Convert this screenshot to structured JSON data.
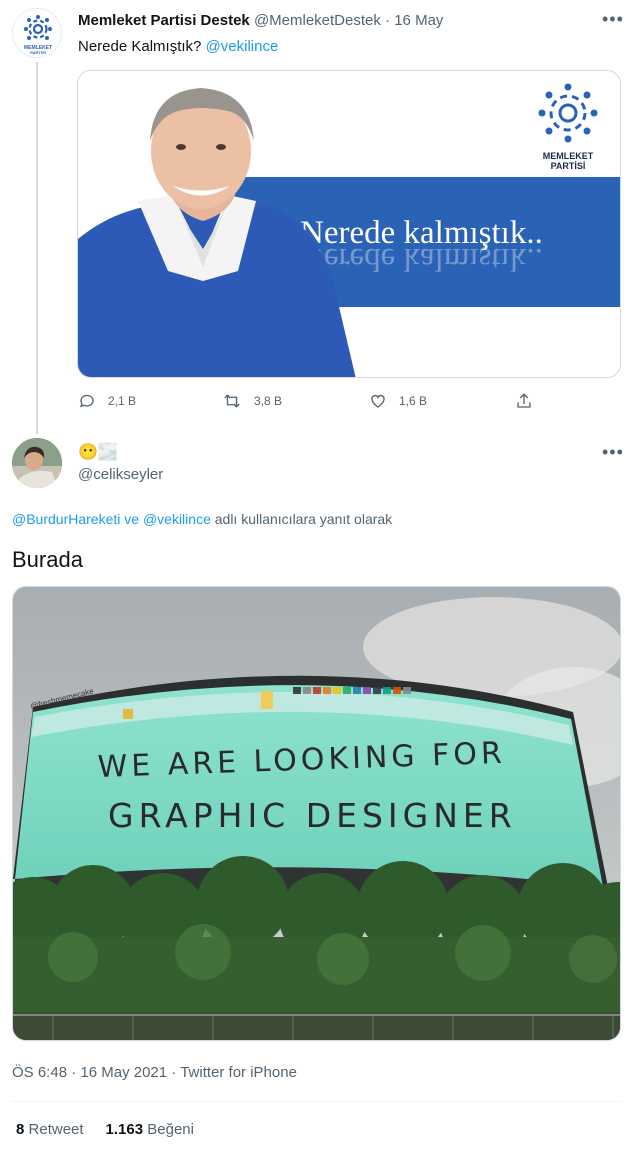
{
  "quoted_tweet": {
    "author_name": "Memleket Partisi Destek",
    "author_handle": "@MemleketDestek",
    "date": "16 May",
    "text_plain": "Nerede Kalmıştık?",
    "text_mention": "@vekilince",
    "card": {
      "logo_text_line1": "MEMLEKET",
      "logo_text_line2": "PARTİSİ",
      "banner_text": "Nerede kalmıştık..",
      "banner_color": "#2a62b5"
    },
    "actions": {
      "replies": "2,1 B",
      "retweets": "3,8 B",
      "likes": "1,6 B"
    }
  },
  "main_tweet": {
    "author_emoji": "😶🌫️",
    "author_handle": "@celikseyler",
    "reply_to_1": "@BurdurHareketi",
    "reply_conj": "ve",
    "reply_to_2": "@vekilince",
    "reply_suffix": "adlı kullanıcılara yanıt olarak",
    "text": "Burada",
    "photo": {
      "watermark": "@freshmemecake",
      "line1": "WE ARE LOOKING FOR",
      "line2": "GRAPHIC DESIGNER"
    },
    "time": "ÖS 6:48",
    "date": "16 May 2021",
    "source": "Twitter for iPhone",
    "retweet_count": "8",
    "retweet_label": "Retweet",
    "like_count": "1.163",
    "like_label": "Beğeni"
  },
  "colors": {
    "link": "#1d9bf0",
    "muted": "#536471",
    "screen_cyan": "#7fdcc6"
  }
}
